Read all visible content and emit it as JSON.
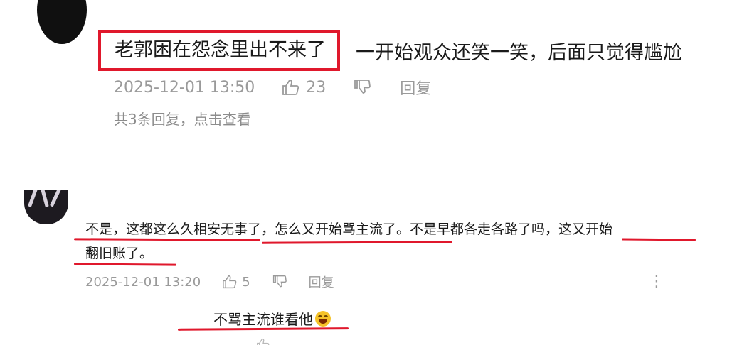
{
  "comment1": {
    "highlighted_text": "老郭困在怨念里出不来了",
    "rest_text": "一开始观众还笑一笑，后面只觉得尴尬",
    "timestamp": "2025-12-01 13:50",
    "likes": "23",
    "reply_label": "回复",
    "replies_link": "共3条回复，点击查看"
  },
  "comment2": {
    "line1": "不是，这都这么久相安无事了，怎么又开始骂主流了。不是早都各走各路了吗，这又开始",
    "line2": "翻旧账了。",
    "timestamp": "2025-12-01 13:20",
    "likes": "5",
    "reply_label": "回复",
    "more_label": "⋮"
  },
  "reply_preview": {
    "text": "不骂主流谁看他"
  },
  "colors": {
    "annotation_red": "#e0182c",
    "meta_gray": "#9a9a9a"
  },
  "icons": [
    "thumbs-up-icon",
    "thumbs-down-icon",
    "more-icon",
    "laughing-emoji-icon"
  ]
}
